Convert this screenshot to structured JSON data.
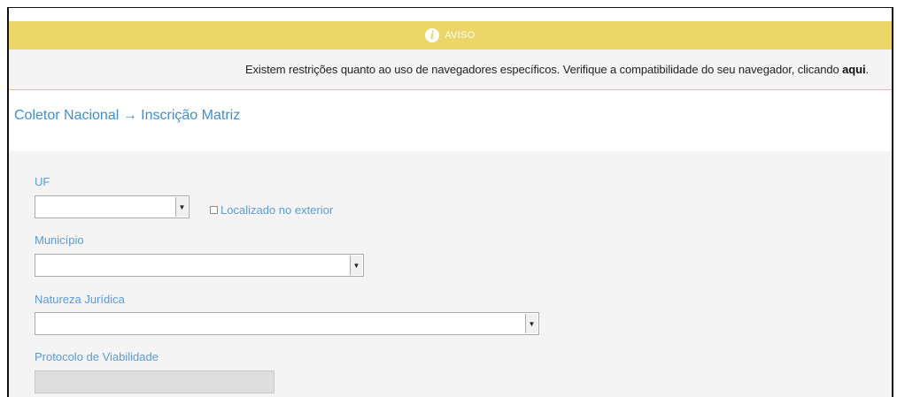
{
  "warning": {
    "title": "AVISO",
    "message_prefix": "Existem restrições quanto ao uso de navegadores específicos. Verifique a compatibilidade do seu navegador, clicando ",
    "link_text": "aqui",
    "message_suffix": "."
  },
  "breadcrumb": "Coletor Nacional → Inscrição Matriz",
  "form": {
    "uf_label": "UF",
    "uf_value": "",
    "abroad_label": "Localizado no exterior",
    "abroad_checked": false,
    "municipio_label": "Município",
    "municipio_value": "",
    "natureza_label": "Natureza Jurídica",
    "natureza_value": "",
    "protocolo_label": "Protocolo de Viabilidade",
    "protocolo_value": ""
  },
  "colors": {
    "warning_bar": "#ecd668",
    "link_blue": "#3d8ed4",
    "label_blue": "#5a9bd8",
    "panel_gray": "#f4f4f4"
  }
}
